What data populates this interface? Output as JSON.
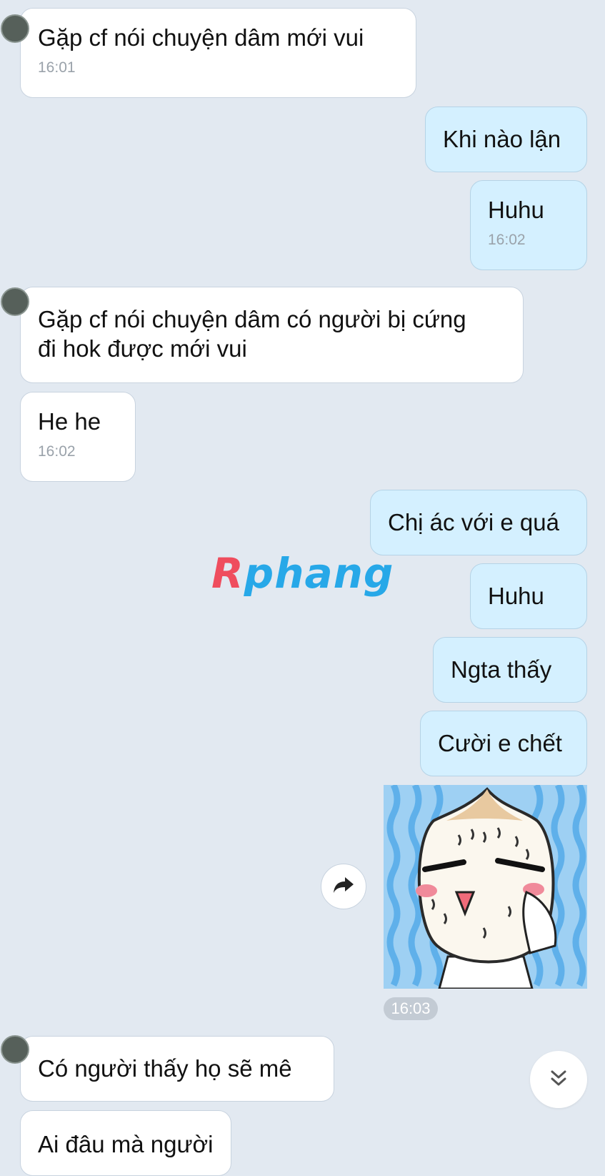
{
  "messages": [
    {
      "text": "Gặp cf nói chuyện dâm mới vui",
      "time": "16:01"
    },
    {
      "text": "Khi nào lận"
    },
    {
      "text": "Huhu",
      "time": "16:02"
    },
    {
      "text_line1": "Gặp cf nói chuyện dâm có người bị cứng",
      "text_line2": "đi hok được mới vui"
    },
    {
      "text": "He he",
      "time": "16:02"
    },
    {
      "text": "Chị ác với e quá"
    },
    {
      "text": "Huhu"
    },
    {
      "text": "Ngta thấy"
    },
    {
      "text": "Cười e chết"
    },
    {
      "sticker": "crying-dumpling-sticker",
      "time": "16:03"
    },
    {
      "text": "Có người thấy họ sẽ mê"
    },
    {
      "text": "Ai đâu mà người"
    }
  ],
  "watermark": {
    "part1": "R",
    "part2": "phang"
  },
  "icons": {
    "share": "share-forward-icon",
    "scroll": "double-chevron-down-icon"
  },
  "colors": {
    "background": "#e2e9f1",
    "incoming_bubble": "#ffffff",
    "outgoing_bubble": "#d4f0ff",
    "time_text": "#9aa2aa"
  }
}
